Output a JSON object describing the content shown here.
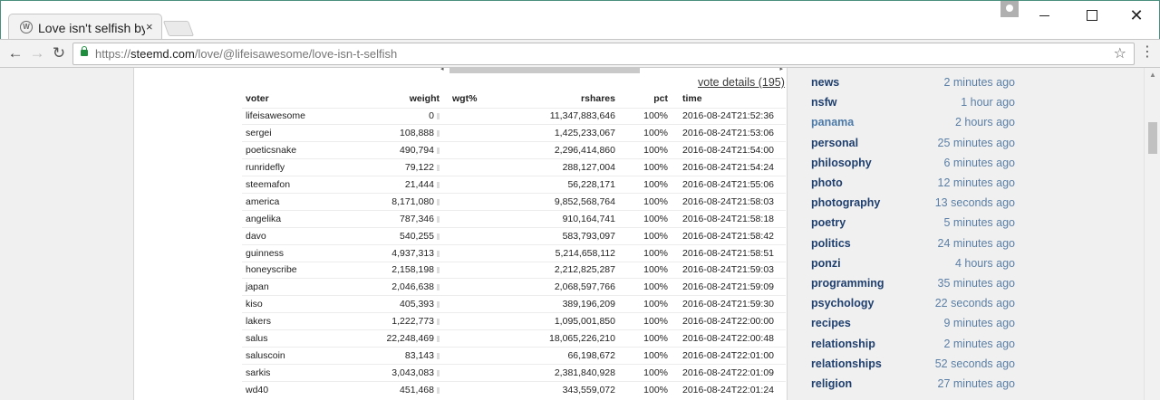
{
  "browser": {
    "tab_title": "Love isn't selfish by",
    "tab_close": "×",
    "url_scheme": "https://",
    "url_host": "steemd.com",
    "url_path": "/love/@lifeisawesome/love-isn-t-selfish"
  },
  "icons": {
    "back": "←",
    "forward": "→",
    "reload": "↻",
    "star": "☆",
    "menu": "⋮",
    "close": "✕",
    "hscroll_left": "◂",
    "hscroll_right": "▸",
    "scroll_up": "▲"
  },
  "votes": {
    "details_link": "vote details (195)",
    "columns": {
      "voter": "voter",
      "weight": "weight",
      "wgt": "wgt%",
      "rshares": "rshares",
      "pct": "pct",
      "time": "time"
    },
    "rows": [
      {
        "voter": "lifeisawesome",
        "weight": "0",
        "rshares": "11,347,883,646",
        "pct": "100%",
        "time": "2016-08-24T21:52:36"
      },
      {
        "voter": "sergei",
        "weight": "108,888",
        "rshares": "1,425,233,067",
        "pct": "100%",
        "time": "2016-08-24T21:53:06"
      },
      {
        "voter": "poeticsnake",
        "weight": "490,794",
        "rshares": "2,296,414,860",
        "pct": "100%",
        "time": "2016-08-24T21:54:00"
      },
      {
        "voter": "runridefly",
        "weight": "79,122",
        "rshares": "288,127,004",
        "pct": "100%",
        "time": "2016-08-24T21:54:24"
      },
      {
        "voter": "steemafon",
        "weight": "21,444",
        "rshares": "56,228,171",
        "pct": "100%",
        "time": "2016-08-24T21:55:06"
      },
      {
        "voter": "america",
        "weight": "8,171,080",
        "rshares": "9,852,568,764",
        "pct": "100%",
        "time": "2016-08-24T21:58:03"
      },
      {
        "voter": "angelika",
        "weight": "787,346",
        "rshares": "910,164,741",
        "pct": "100%",
        "time": "2016-08-24T21:58:18"
      },
      {
        "voter": "davo",
        "weight": "540,255",
        "rshares": "583,793,097",
        "pct": "100%",
        "time": "2016-08-24T21:58:42"
      },
      {
        "voter": "guinness",
        "weight": "4,937,313",
        "rshares": "5,214,658,112",
        "pct": "100%",
        "time": "2016-08-24T21:58:51"
      },
      {
        "voter": "honeyscribe",
        "weight": "2,158,198",
        "rshares": "2,212,825,287",
        "pct": "100%",
        "time": "2016-08-24T21:59:03"
      },
      {
        "voter": "japan",
        "weight": "2,046,638",
        "rshares": "2,068,597,766",
        "pct": "100%",
        "time": "2016-08-24T21:59:09"
      },
      {
        "voter": "kiso",
        "weight": "405,393",
        "rshares": "389,196,209",
        "pct": "100%",
        "time": "2016-08-24T21:59:30"
      },
      {
        "voter": "lakers",
        "weight": "1,222,773",
        "rshares": "1,095,001,850",
        "pct": "100%",
        "time": "2016-08-24T22:00:00"
      },
      {
        "voter": "salus",
        "weight": "22,248,469",
        "rshares": "18,065,226,210",
        "pct": "100%",
        "time": "2016-08-24T22:00:48"
      },
      {
        "voter": "saluscoin",
        "weight": "83,143",
        "rshares": "66,198,672",
        "pct": "100%",
        "time": "2016-08-24T22:01:00"
      },
      {
        "voter": "sarkis",
        "weight": "3,043,083",
        "rshares": "2,381,840,928",
        "pct": "100%",
        "time": "2016-08-24T22:01:09"
      },
      {
        "voter": "wd40",
        "weight": "451,468",
        "rshares": "343,559,072",
        "pct": "100%",
        "time": "2016-08-24T22:01:24"
      }
    ]
  },
  "tags": [
    {
      "name": "news",
      "time": "2 minutes ago"
    },
    {
      "name": "nsfw",
      "time": "1 hour ago"
    },
    {
      "name": "panama",
      "time": "2 hours ago"
    },
    {
      "name": "personal",
      "time": "25 minutes ago"
    },
    {
      "name": "philosophy",
      "time": "6 minutes ago"
    },
    {
      "name": "photo",
      "time": "12 minutes ago"
    },
    {
      "name": "photography",
      "time": "13 seconds ago"
    },
    {
      "name": "poetry",
      "time": "5 minutes ago"
    },
    {
      "name": "politics",
      "time": "24 minutes ago"
    },
    {
      "name": "ponzi",
      "time": "4 hours ago"
    },
    {
      "name": "programming",
      "time": "35 minutes ago"
    },
    {
      "name": "psychology",
      "time": "22 seconds ago"
    },
    {
      "name": "recipes",
      "time": "9 minutes ago"
    },
    {
      "name": "relationship",
      "time": "2 minutes ago"
    },
    {
      "name": "relationships",
      "time": "52 seconds ago"
    },
    {
      "name": "religion",
      "time": "27 minutes ago"
    }
  ],
  "colors": {
    "tag_link": "#1f3f6e",
    "tag_time": "#5b7fa6",
    "secure_lock": "#1e8e3e"
  }
}
